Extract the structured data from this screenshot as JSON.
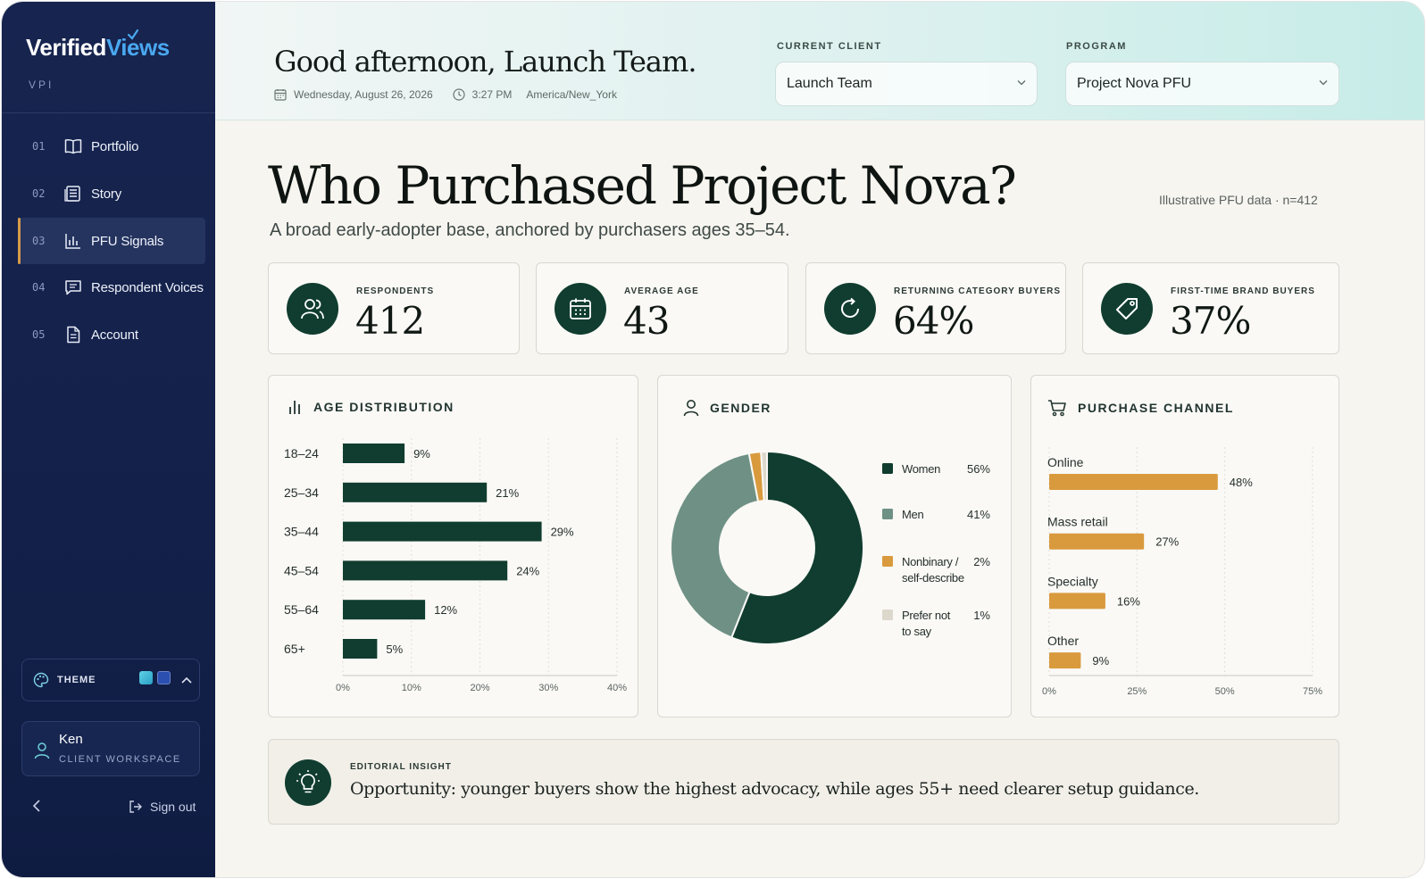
{
  "sidebar": {
    "brand_a": "Verified",
    "brand_b": "Views",
    "brand_sub": "VPI",
    "items": [
      {
        "num": "01",
        "label": "Portfolio",
        "icon": "book-icon"
      },
      {
        "num": "02",
        "label": "Story",
        "icon": "list-document-icon"
      },
      {
        "num": "03",
        "label": "PFU Signals",
        "icon": "bar-chart-icon",
        "active": true
      },
      {
        "num": "04",
        "label": "Respondent Voices",
        "icon": "chat-bubble-icon"
      },
      {
        "num": "05",
        "label": "Account",
        "icon": "document-icon"
      }
    ],
    "theme_label": "THEME",
    "theme_swatches": [
      "#3fb6d6",
      "#2a4fb0"
    ],
    "user_name": "Ken",
    "user_role": "CLIENT WORKSPACE",
    "signout_label": "Sign out"
  },
  "header": {
    "greeting": "Good afternoon, Launch Team.",
    "date": "Wednesday, August 26, 2026",
    "time": "3:27 PM",
    "timezone": "America/New_York",
    "client_label": "CURRENT CLIENT",
    "client_value": "Launch Team",
    "program_label": "PROGRAM",
    "program_value": "Project Nova PFU"
  },
  "main": {
    "title": "Who Purchased Project Nova?",
    "subtitle": "A broad early-adopter base, anchored by purchasers ages 35–54.",
    "note": "Illustrative PFU data · n=412",
    "kpis": [
      {
        "label": "RESPONDENTS",
        "value": "412",
        "icon": "users-icon"
      },
      {
        "label": "AVERAGE AGE",
        "value": "43",
        "icon": "calendar-icon"
      },
      {
        "label": "RETURNING CATEGORY BUYERS",
        "value": "64%",
        "icon": "refresh-icon"
      },
      {
        "label": "FIRST-TIME BRAND BUYERS",
        "value": "37%",
        "icon": "tag-icon"
      }
    ],
    "insight_label": "EDITORIAL INSIGHT",
    "insight_text": "Opportunity: younger buyers show the highest advocacy, while ages 55+ need clearer setup guidance."
  },
  "colors": {
    "primary": "#103d2f",
    "men": "#6f9185",
    "accent": "#d99a3e",
    "prefer_not": "#ddd8cc",
    "sidebar": "#16244f"
  },
  "chart_data": [
    {
      "type": "bar",
      "title": "AGE DISTRIBUTION",
      "orientation": "horizontal",
      "categories": [
        "18–24",
        "25–34",
        "35–44",
        "45–54",
        "55–64",
        "65+"
      ],
      "values": [
        9,
        21,
        29,
        24,
        12,
        5
      ],
      "value_labels": [
        "9%",
        "21%",
        "29%",
        "24%",
        "12%",
        "5%"
      ],
      "xlim": [
        0,
        40
      ],
      "xticks": [
        "0%",
        "10%",
        "20%",
        "30%",
        "40%"
      ],
      "grid": true,
      "color": "#103d2f"
    },
    {
      "type": "pie",
      "title": "GENDER",
      "donut": true,
      "legend": "right",
      "slices": [
        {
          "name": "Women",
          "value": 56,
          "label": "56%",
          "color": "#103d2f"
        },
        {
          "name": "Men",
          "value": 41,
          "label": "41%",
          "color": "#6f9185"
        },
        {
          "name": "Nonbinary /",
          "name2": "self-describe",
          "value": 2,
          "label": "2%",
          "color": "#d99a3e"
        },
        {
          "name": "Prefer not",
          "name2": "to say",
          "value": 1,
          "label": "1%",
          "color": "#ddd8cc"
        }
      ]
    },
    {
      "type": "bar",
      "title": "PURCHASE CHANNEL",
      "orientation": "horizontal",
      "categories": [
        "Online",
        "Mass retail",
        "Specialty",
        "Other"
      ],
      "values": [
        48,
        27,
        16,
        9
      ],
      "value_labels": [
        "48%",
        "27%",
        "16%",
        "9%"
      ],
      "xlim": [
        0,
        75
      ],
      "xticks": [
        "0%",
        "25%",
        "50%",
        "75%"
      ],
      "grid": true,
      "color": "#d99a3e"
    }
  ]
}
